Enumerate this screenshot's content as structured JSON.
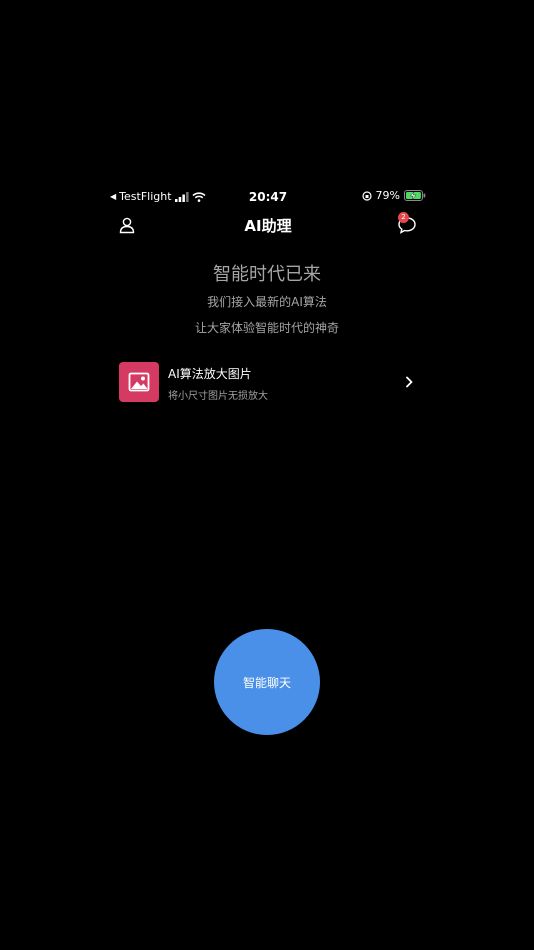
{
  "status_bar": {
    "back_app": "TestFlight",
    "time": "20:47",
    "battery_percent": "79%",
    "battery_level": 0.79
  },
  "nav": {
    "title": "AI助理",
    "badge_count": "2",
    "left_icon": "user-icon",
    "right_icon": "chat-bubble-icon"
  },
  "hero": {
    "title": "智能时代已来",
    "line1": "我们接入最新的AI算法",
    "line2": "让大家体验智能时代的神奇"
  },
  "features": [
    {
      "title": "AI算法放大图片",
      "subtitle": "将小尺寸图片无损放大",
      "icon": "image-icon",
      "icon_color": "#d43a62"
    }
  ],
  "chat_button": {
    "label": "智能聊天",
    "color": "#4a90e8"
  }
}
